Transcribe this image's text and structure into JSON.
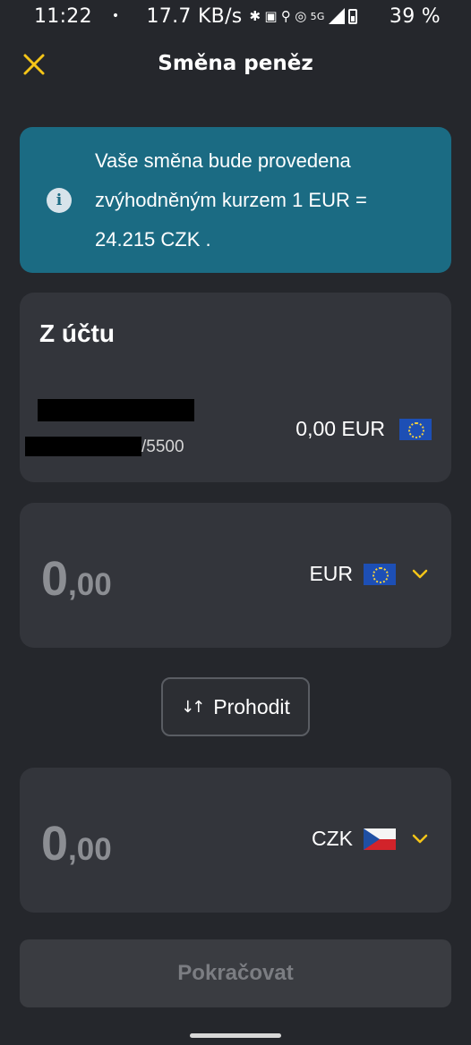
{
  "status_bar": {
    "time": "11:22",
    "dot": "•",
    "speed": "17.7 KB/s",
    "network": "5G",
    "battery": "39 %"
  },
  "header": {
    "title": "Směna peněz",
    "close_icon": "close-icon",
    "accent_color": "#f5c518"
  },
  "info_banner": {
    "icon": "info-icon",
    "text": "Vaše směna bude provedena zvýhodněným kurzem 1 EUR = 24.215 CZK .",
    "background": "#1b6b83"
  },
  "from_account": {
    "title": "Z účtu",
    "account_suffix": "/5500",
    "balance": "0,00 EUR",
    "flag_icon": "eu-flag-icon"
  },
  "sell": {
    "amount_int": "0",
    "amount_dec": ",00",
    "currency": "EUR",
    "flag_icon": "eu-flag-icon"
  },
  "swap": {
    "icon": "swap-icon",
    "label": "Prohodit"
  },
  "buy": {
    "amount_int": "0",
    "amount_dec": ",00",
    "currency": "CZK",
    "flag_icon": "cz-flag-icon"
  },
  "footer": {
    "continue_label": "Pokračovat"
  }
}
